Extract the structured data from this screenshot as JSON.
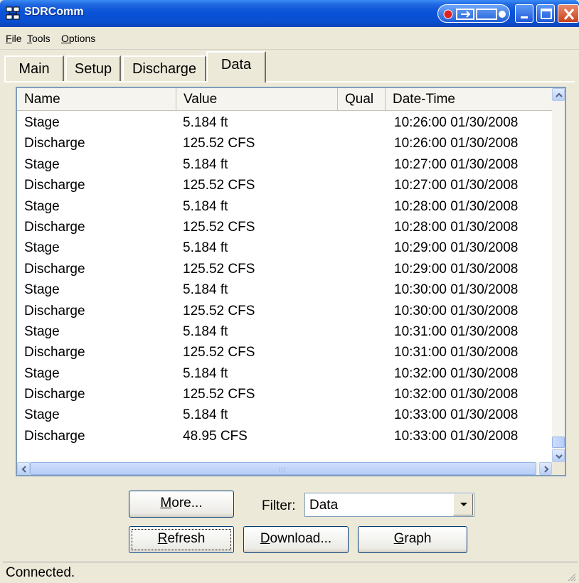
{
  "window": {
    "title": "SDRComm"
  },
  "menu": [
    {
      "label": "File",
      "accel": "F",
      "rest": "ile"
    },
    {
      "label": "Tools",
      "accel": "T",
      "rest": "ools"
    },
    {
      "label": "Options",
      "accel": "O",
      "rest": "ptions"
    }
  ],
  "tabs": [
    "Main",
    "Setup",
    "Discharge",
    "Data"
  ],
  "active_tab": "Data",
  "table": {
    "columns": [
      "Name",
      "Value",
      "Qual",
      "Date-Time"
    ],
    "rows": [
      {
        "name": "Stage",
        "value": "5.184 ft",
        "qual": "",
        "datetime": "10:26:00 01/30/2008"
      },
      {
        "name": "Discharge",
        "value": "125.52 CFS",
        "qual": "",
        "datetime": "10:26:00 01/30/2008"
      },
      {
        "name": "Stage",
        "value": "5.184 ft",
        "qual": "",
        "datetime": "10:27:00 01/30/2008"
      },
      {
        "name": "Discharge",
        "value": "125.52 CFS",
        "qual": "",
        "datetime": "10:27:00 01/30/2008"
      },
      {
        "name": "Stage",
        "value": "5.184 ft",
        "qual": "",
        "datetime": "10:28:00 01/30/2008"
      },
      {
        "name": "Discharge",
        "value": "125.52 CFS",
        "qual": "",
        "datetime": "10:28:00 01/30/2008"
      },
      {
        "name": "Stage",
        "value": "5.184 ft",
        "qual": "",
        "datetime": "10:29:00 01/30/2008"
      },
      {
        "name": "Discharge",
        "value": "125.52 CFS",
        "qual": "",
        "datetime": "10:29:00 01/30/2008"
      },
      {
        "name": "Stage",
        "value": "5.184 ft",
        "qual": "",
        "datetime": "10:30:00 01/30/2008"
      },
      {
        "name": "Discharge",
        "value": "125.52 CFS",
        "qual": "",
        "datetime": "10:30:00 01/30/2008"
      },
      {
        "name": "Stage",
        "value": "5.184 ft",
        "qual": "",
        "datetime": "10:31:00 01/30/2008"
      },
      {
        "name": "Discharge",
        "value": "125.52 CFS",
        "qual": "",
        "datetime": "10:31:00 01/30/2008"
      },
      {
        "name": "Stage",
        "value": "5.184 ft",
        "qual": "",
        "datetime": "10:32:00 01/30/2008"
      },
      {
        "name": "Discharge",
        "value": "125.52 CFS",
        "qual": "",
        "datetime": "10:32:00 01/30/2008"
      },
      {
        "name": "Stage",
        "value": "5.184 ft",
        "qual": "",
        "datetime": "10:33:00 01/30/2008"
      },
      {
        "name": "Discharge",
        "value": "48.95 CFS",
        "qual": "",
        "datetime": "10:33:00 01/30/2008"
      }
    ]
  },
  "buttons": {
    "more": {
      "accel": "M",
      "rest": "ore..."
    },
    "refresh": {
      "accel": "R",
      "rest": "efresh"
    },
    "download": {
      "accel": "D",
      "rest": "ownload..."
    },
    "graph": {
      "accel": "G",
      "rest": "raph"
    }
  },
  "filter": {
    "label": "Filter:",
    "value": "Data"
  },
  "status": {
    "text": "Connected."
  },
  "colors": {
    "titlebar": "#0a52d8",
    "face": "#ece9d8",
    "list_border": "#7f9db9"
  }
}
